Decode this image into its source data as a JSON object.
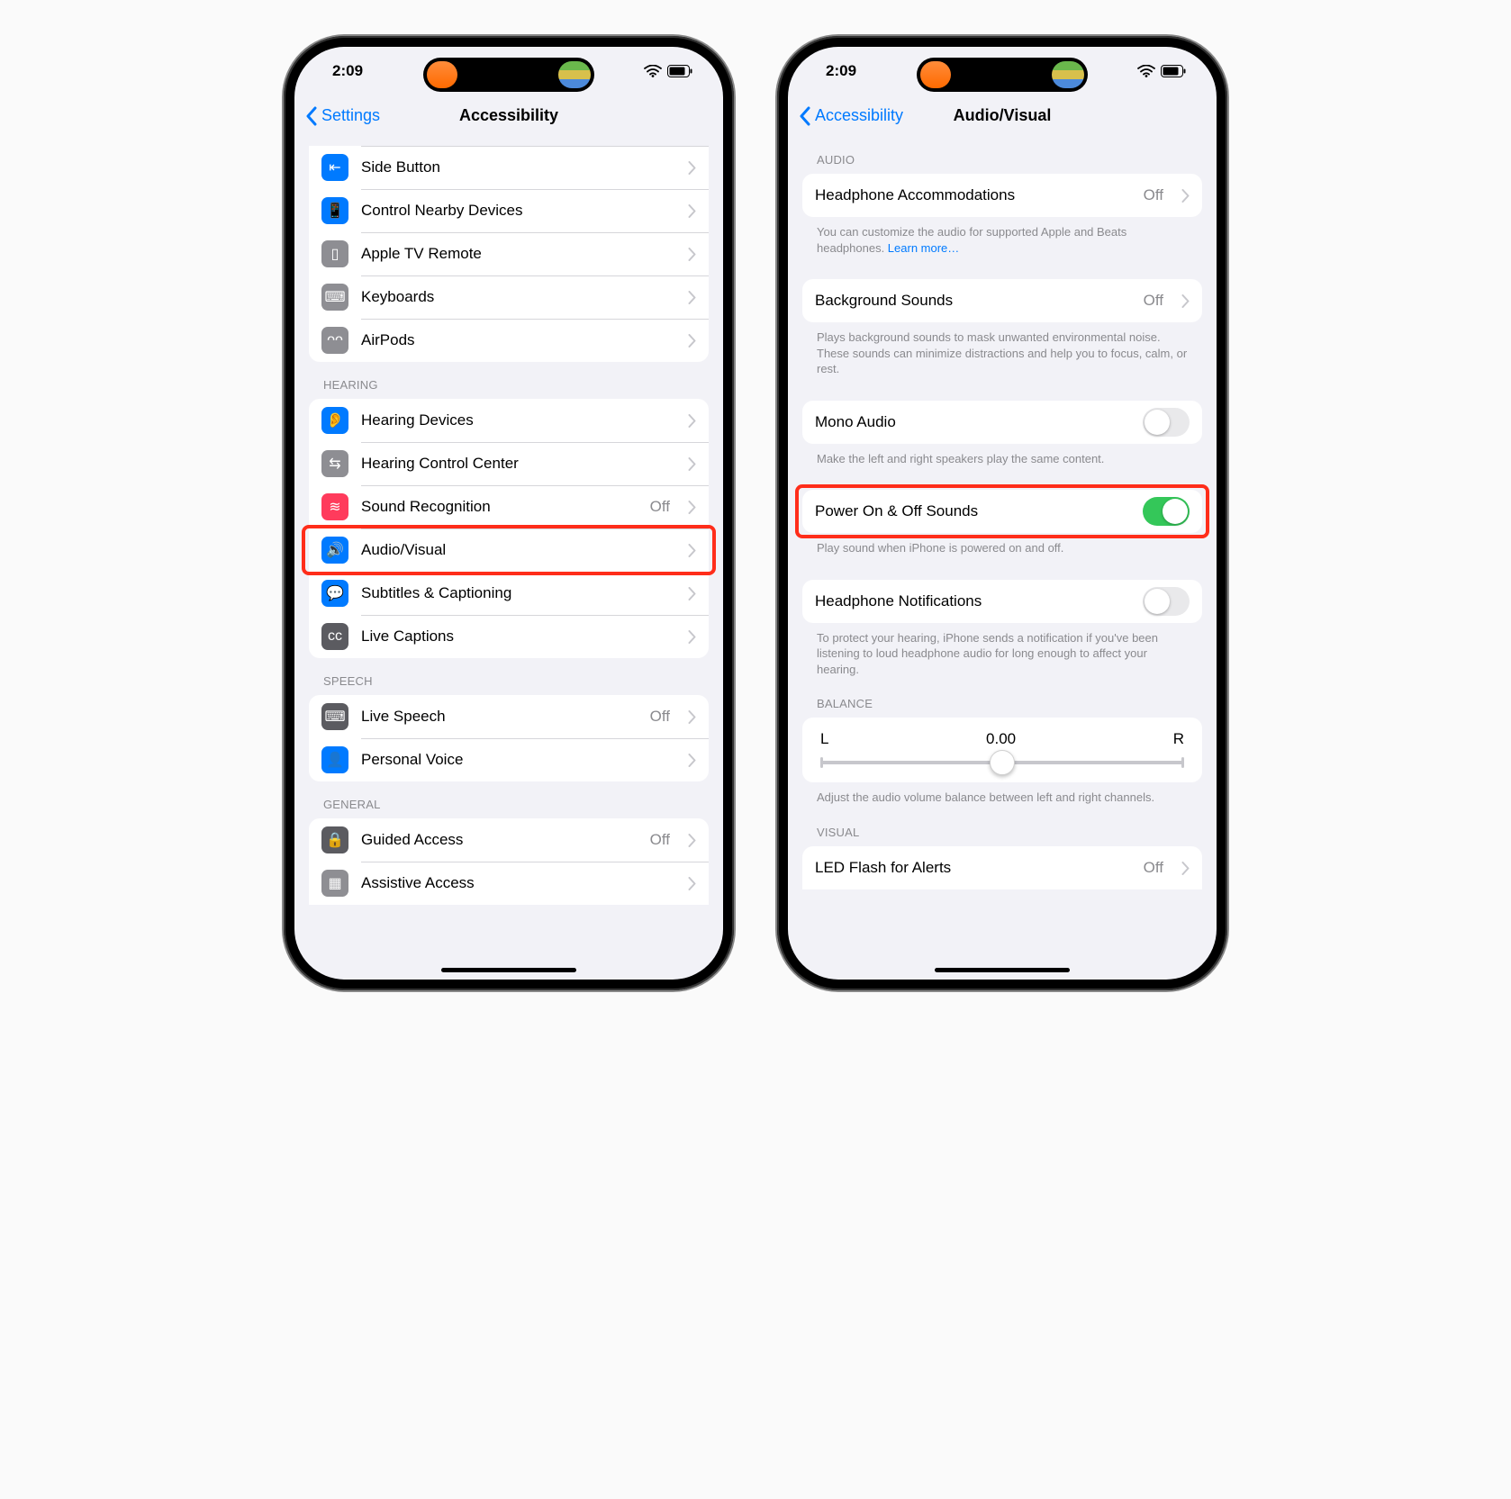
{
  "status": {
    "time": "2:09"
  },
  "left": {
    "back": "Settings",
    "title": "Accessibility",
    "group_physical": [
      {
        "key": "side-button",
        "label": "Side Button",
        "icon": "side-button-icon",
        "color": "#007aff"
      },
      {
        "key": "nearby",
        "label": "Control Nearby Devices",
        "icon": "nearby-icon",
        "color": "#007aff"
      },
      {
        "key": "appletv",
        "label": "Apple TV Remote",
        "icon": "remote-icon",
        "color": "#8e8e93"
      },
      {
        "key": "keyboards",
        "label": "Keyboards",
        "icon": "keyboard-icon",
        "color": "#8e8e93"
      },
      {
        "key": "airpods",
        "label": "AirPods",
        "icon": "airpods-icon",
        "color": "#8e8e93"
      }
    ],
    "hearing_header": "Hearing",
    "group_hearing": [
      {
        "key": "hearing-devices",
        "label": "Hearing Devices",
        "icon": "ear-icon",
        "color": "#007aff"
      },
      {
        "key": "hearing-cc",
        "label": "Hearing Control Center",
        "icon": "switches-icon",
        "color": "#8e8e93"
      },
      {
        "key": "sound-rec",
        "label": "Sound Recognition",
        "icon": "wave-icon",
        "color": "#ff3b5c",
        "value": "Off"
      },
      {
        "key": "audio-visual",
        "label": "Audio/Visual",
        "icon": "speaker-eye-icon",
        "color": "#007aff",
        "highlight": true
      },
      {
        "key": "subtitles",
        "label": "Subtitles & Captioning",
        "icon": "caption-icon",
        "color": "#007aff"
      },
      {
        "key": "live-captions",
        "label": "Live Captions",
        "icon": "live-caption-icon",
        "color": "#5b5b60"
      }
    ],
    "speech_header": "Speech",
    "group_speech": [
      {
        "key": "live-speech",
        "label": "Live Speech",
        "icon": "live-speech-icon",
        "color": "#5b5b60",
        "value": "Off"
      },
      {
        "key": "personal-voice",
        "label": "Personal Voice",
        "icon": "person-voice-icon",
        "color": "#007aff"
      }
    ],
    "general_header": "General",
    "group_general": [
      {
        "key": "guided-access",
        "label": "Guided Access",
        "icon": "lock-icon",
        "color": "#5b5b60",
        "value": "Off"
      },
      {
        "key": "assistive",
        "label": "Assistive Access",
        "icon": "grid-icon",
        "color": "#8e8e93"
      }
    ]
  },
  "right": {
    "back": "Accessibility",
    "title": "Audio/Visual",
    "audio_header": "Audio",
    "headphone_accom": {
      "label": "Headphone Accommodations",
      "value": "Off"
    },
    "headphone_accom_footer": "You can customize the audio for supported Apple and Beats headphones. ",
    "headphone_accom_link": "Learn more…",
    "bg_sounds": {
      "label": "Background Sounds",
      "value": "Off"
    },
    "bg_sounds_footer": "Plays background sounds to mask unwanted environmental noise. These sounds can minimize distractions and help you to focus, calm, or rest.",
    "mono_audio": {
      "label": "Mono Audio"
    },
    "mono_audio_footer": "Make the left and right speakers play the same content.",
    "power_sounds": {
      "label": "Power On & Off Sounds"
    },
    "power_sounds_footer": "Play sound when iPhone is powered on and off.",
    "headphone_notif": {
      "label": "Headphone Notifications"
    },
    "headphone_notif_footer": "To protect your hearing, iPhone sends a notification if you've been listening to loud headphone audio for long enough to affect your hearing.",
    "balance_header": "Balance",
    "balance": {
      "left": "L",
      "value": "0.00",
      "right": "R"
    },
    "balance_footer": "Adjust the audio volume balance between left and right channels.",
    "visual_header": "Visual",
    "led_flash": {
      "label": "LED Flash for Alerts",
      "value": "Off"
    }
  }
}
